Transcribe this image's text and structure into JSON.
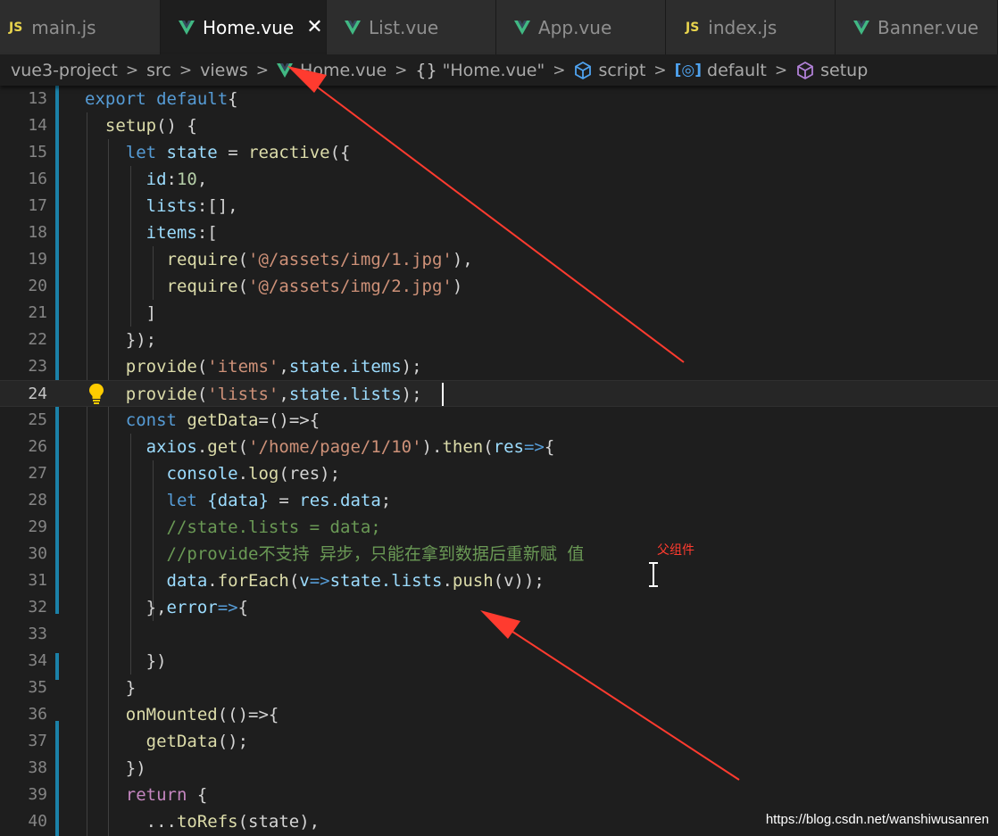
{
  "tabs": [
    {
      "label": "main.js",
      "icon": "js-icon",
      "active": false
    },
    {
      "label": "Home.vue",
      "icon": "vue-icon",
      "active": true
    },
    {
      "label": "List.vue",
      "icon": "vue-icon",
      "active": false
    },
    {
      "label": "App.vue",
      "icon": "vue-icon",
      "active": false
    },
    {
      "label": "index.js",
      "icon": "js-icon",
      "active": false
    },
    {
      "label": "Banner.vue",
      "icon": "vue-icon",
      "active": false
    }
  ],
  "js_icon_text": "JS",
  "close_glyph": "✕",
  "breadcrumb": {
    "project": "vue3-project",
    "src": "src",
    "views": "views",
    "file": "Home.vue",
    "module_braces": "{}",
    "module": "\"Home.vue\"",
    "script": "script",
    "default": "default",
    "setup": "setup"
  },
  "editor": {
    "current_line": 24,
    "lines": [
      {
        "n": "13"
      },
      {
        "n": "14"
      },
      {
        "n": "15"
      },
      {
        "n": "16"
      },
      {
        "n": "17"
      },
      {
        "n": "18"
      },
      {
        "n": "19"
      },
      {
        "n": "20"
      },
      {
        "n": "21"
      },
      {
        "n": "22"
      },
      {
        "n": "23"
      },
      {
        "n": "24"
      },
      {
        "n": "25"
      },
      {
        "n": "26"
      },
      {
        "n": "27"
      },
      {
        "n": "28"
      },
      {
        "n": "29"
      },
      {
        "n": "30"
      },
      {
        "n": "31"
      },
      {
        "n": "32"
      },
      {
        "n": "33"
      },
      {
        "n": "34"
      },
      {
        "n": "35"
      },
      {
        "n": "36"
      },
      {
        "n": "37"
      },
      {
        "n": "38"
      },
      {
        "n": "39"
      },
      {
        "n": "40"
      }
    ]
  },
  "code": {
    "export": "export",
    "default": "default",
    "brace_open": "{",
    "setup": "setup",
    "setup_sig": "() {",
    "let": "let",
    "state": "state",
    "eq": " = ",
    "reactive": "reactive",
    "paren_brace": "({",
    "id": "id",
    "colon": ":",
    "ten": "10",
    "comma": ",",
    "lists": "lists",
    "empty_arr": ":[],",
    "items": "items",
    "arr_open": ":[",
    "require": "require",
    "img1": "'@/assets/img/1.jpg'",
    "img2": "'@/assets/img/2.jpg'",
    "paren_close_comma": "),",
    "paren_close": ")",
    "arr_close": "]",
    "close_paren_semi": "});",
    "provide": "provide",
    "items_key": "'items'",
    "lists_key": "'lists'",
    "state_items": "state.items",
    "state_lists": "state.lists",
    "close_semi": ");",
    "const": "const",
    "getData": "getData",
    "arrow_decl": "=()=>{",
    "axios": "axios",
    "get": "get",
    "url": "'/home/page/1/10'",
    "then": "then",
    "res": "res",
    "arrow": "=>",
    "brace": "{",
    "console": "console",
    "log": "log",
    "console_log_args": "(res);",
    "let2": "let",
    "destructure": "{data}",
    "res_data": "res.data",
    "semi": ";",
    "comment1": "//state.lists = data;",
    "comment2": "//provide不支持 异步，只能在拿到数据后重新赋 值",
    "data_foreach": "data",
    "forEach": "forEach",
    "v": "v",
    "push_call": "state.lists",
    "push": "push",
    "push_tail": "(v));",
    "error_line": "},",
    "error": "error",
    "close_paren": "})",
    "close_brace": "}",
    "onMounted": "onMounted",
    "om_open": "(()=>{",
    "getData_call": "getData",
    "call_semi": "();",
    "return": "return",
    "spread": "...",
    "toRefs": "toRefs",
    "toRefs_args": "(state),"
  },
  "annotation": "父组件",
  "watermark": "https://blog.csdn.net/wanshiwusanren",
  "colors": {
    "arrow": "#ff3b2f",
    "vue_green": "#41b883",
    "js_yellow": "#e8d44d"
  }
}
